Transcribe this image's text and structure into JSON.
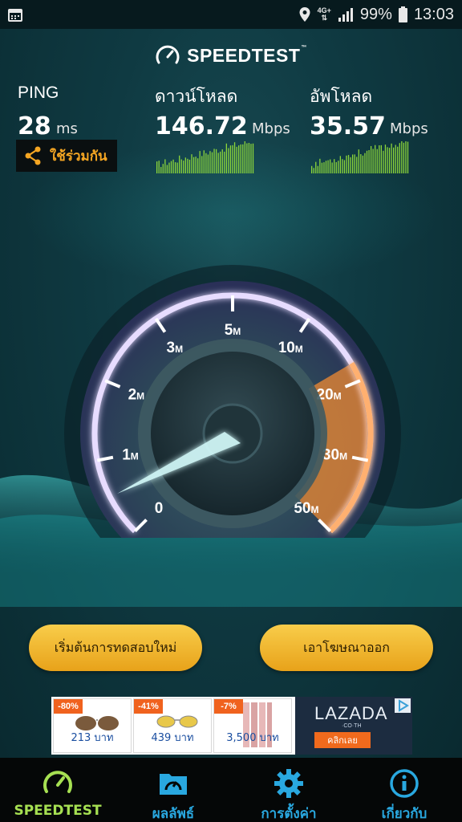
{
  "status_bar": {
    "network": "4G+",
    "battery": "99%",
    "time": "13:03"
  },
  "header": {
    "brand": "SPEEDTEST",
    "trademark": "™"
  },
  "ping": {
    "label": "PING",
    "value": "28",
    "unit": "ms"
  },
  "download": {
    "label": "ดาวน์โหลด",
    "value": "146.72",
    "unit": "Mbps"
  },
  "upload": {
    "label": "อัพโหลด",
    "value": "35.57",
    "unit": "Mbps"
  },
  "share": {
    "label": "ใช้ร่วมกัน"
  },
  "gauge": {
    "ticks": [
      {
        "num": "0",
        "suffix": ""
      },
      {
        "num": "1",
        "suffix": "M"
      },
      {
        "num": "2",
        "suffix": "M"
      },
      {
        "num": "3",
        "suffix": "M"
      },
      {
        "num": "5",
        "suffix": "M"
      },
      {
        "num": "10",
        "suffix": "M"
      },
      {
        "num": "20",
        "suffix": "M"
      },
      {
        "num": "30",
        "suffix": "M"
      },
      {
        "num": "50",
        "suffix": "M"
      }
    ]
  },
  "buttons": {
    "restart": "เริ่มต้นการทดสอบใหม่",
    "remove_ads": "เอาโฆษณาออก"
  },
  "ad": {
    "products": [
      {
        "discount": "-80%",
        "price": "213 บาท"
      },
      {
        "discount": "-41%",
        "price": "439 บาท"
      },
      {
        "discount": "-7%",
        "price": "3,500 บาท"
      }
    ],
    "brand": "LAZADA",
    "brand_sub": "·CO·TH",
    "cta": "คลิกเลย"
  },
  "nav": {
    "items": [
      {
        "label": "SPEEDTEST",
        "icon": "speedometer-icon",
        "active": true
      },
      {
        "label": "ผลลัพธ์",
        "icon": "results-folder-icon",
        "active": false
      },
      {
        "label": "การตั้งค่า",
        "icon": "gear-icon",
        "active": false
      },
      {
        "label": "เกี่ยวกับ",
        "icon": "info-icon",
        "active": false
      }
    ]
  },
  "colors": {
    "accent_yellow": "#f5a623",
    "nav_active": "#a6e052",
    "nav_inactive": "#29a8e0",
    "bar_green": "#8cd63a",
    "gauge_purple": "#b89cf0",
    "gauge_orange": "#f08a32"
  }
}
